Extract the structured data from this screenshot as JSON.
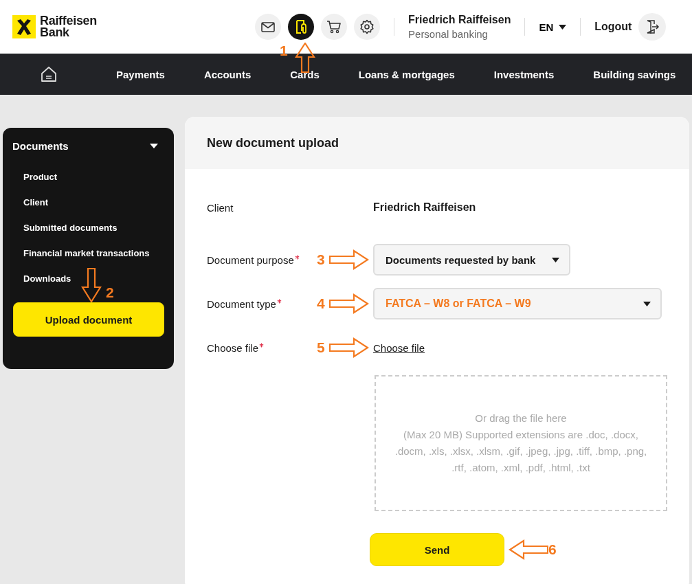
{
  "header": {
    "logo_text": [
      "Raiffeisen",
      "Bank"
    ],
    "icons": [
      {
        "kind": "mail",
        "selected": false
      },
      {
        "kind": "documents",
        "selected": true,
        "callout": {
          "number": "1",
          "kind": "up"
        }
      },
      {
        "kind": "cart",
        "selected": false
      },
      {
        "kind": "settings",
        "selected": false
      }
    ],
    "user": {
      "name": "Friedrich Raiffeisen",
      "role": "Personal banking"
    },
    "language": "EN",
    "logout": "Logout"
  },
  "nav": {
    "items": [
      "Payments",
      "Accounts",
      "Cards",
      "Loans & mortgages",
      "Investments",
      "Building savings"
    ]
  },
  "sidebar": {
    "section": {
      "title": "Documents",
      "expanded": true
    },
    "items": [
      "Product",
      "Client",
      "Submitted documents",
      "Financial market transactions",
      "Downloads"
    ],
    "button": {
      "label": "Upload document",
      "callout": {
        "number": "2",
        "kind": "down"
      }
    }
  },
  "form": {
    "title": "New document upload",
    "rows": [
      {
        "kind": "text",
        "label": "Client",
        "required": false,
        "value": "Friedrich Raiffeisen"
      },
      {
        "kind": "select",
        "label": "Document purpose",
        "required": true,
        "value": "Documents requested by bank",
        "highlighted": false,
        "callout": {
          "number": "3",
          "kind": "right"
        }
      },
      {
        "kind": "select",
        "label": "Document type",
        "required": true,
        "value": "FATCA – W8 or FATCA – W9",
        "highlighted": true,
        "callout": {
          "number": "4",
          "kind": "right"
        }
      },
      {
        "kind": "link",
        "label": "Choose file",
        "required": true,
        "value": "Choose file",
        "callout": {
          "number": "5",
          "kind": "right"
        }
      }
    ],
    "dropzone": {
      "title": "Or drag the file here",
      "text": "(Max 20 MB) Supported extensions are .doc, .docx, .docm, .xls, .xlsx, .xlsm, .gif, .jpeg, .jpg, .tiff, .bmp, .png, .rtf, .atom, .xml, .pdf, .html, .txt"
    },
    "send": {
      "label": "Send",
      "callout": {
        "number": "6",
        "kind": "left"
      }
    }
  }
}
